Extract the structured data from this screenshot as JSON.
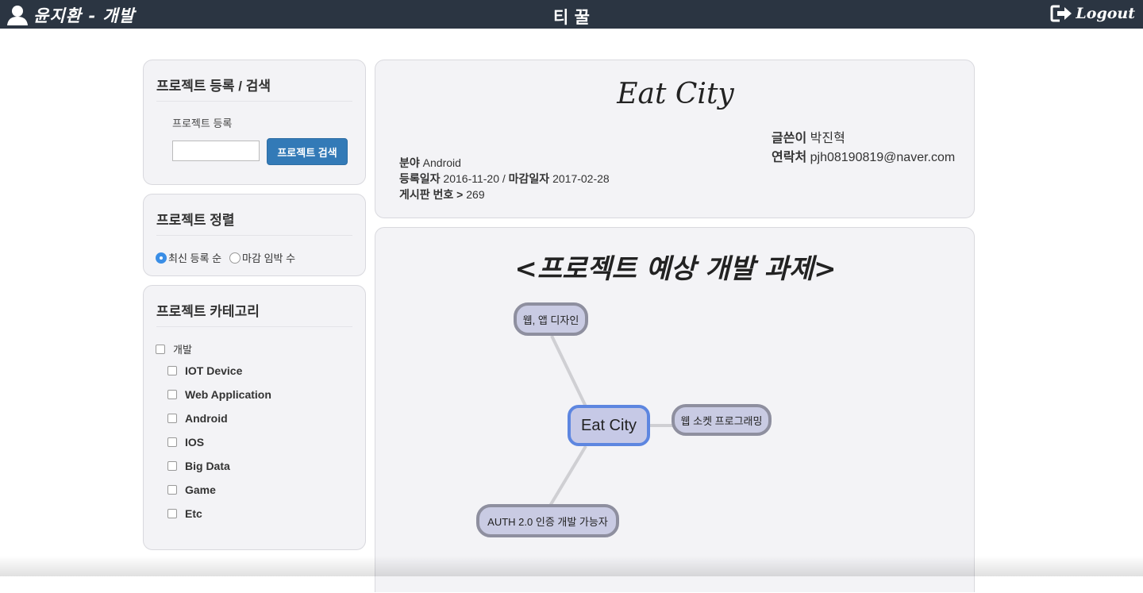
{
  "topbar": {
    "username": "윤지환 - 개발",
    "brand": "티 꿀",
    "logout_label": "Logout"
  },
  "search_panel": {
    "title": "프로젝트 등록 / 검색",
    "register_label": "프로젝트 등록",
    "input_value": "",
    "search_button": "프로젝트 검색"
  },
  "sort_panel": {
    "title": "프로젝트 정렬",
    "options": [
      {
        "label": "최신 등록 순",
        "checked": true
      },
      {
        "label": "마감 임박 수",
        "checked": false
      }
    ]
  },
  "category_panel": {
    "title": "프로젝트 카테고리",
    "parent": "개발",
    "children": [
      "IOT Device",
      "Web Application",
      "Android",
      "IOS",
      "Big Data",
      "Game",
      "Etc"
    ]
  },
  "project": {
    "title": "Eat City",
    "writer_label": "글쓴이",
    "writer": "박진혁",
    "contact_label": "연락처",
    "contact": "pjh08190819@naver.com",
    "field_label": "분야",
    "field": "Android",
    "reg_date_label": "등록일자",
    "reg_date": "2016-11-20",
    "separator": "/",
    "deadline_label": "마감일자",
    "deadline": "2017-02-28",
    "board_label": "게시판 번호 >",
    "board_no": "269"
  },
  "mindmap": {
    "title": "<프로젝트 예상 개발 과제>",
    "center": "Eat City",
    "nodes": [
      "웹, 앱 디자인",
      "웹 소켓 프로그래밍",
      "AUTH 2.0 인증 개발 가능자"
    ]
  }
}
